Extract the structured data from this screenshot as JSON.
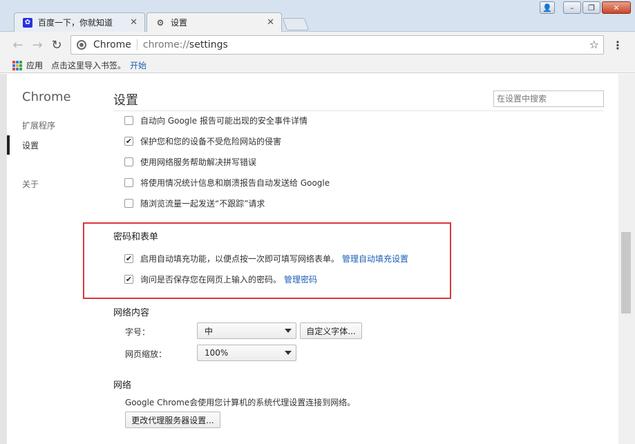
{
  "window": {
    "controls": {
      "user": "👤",
      "minimize": "–",
      "maximize": "❐",
      "close": "✕"
    }
  },
  "tabs": [
    {
      "title": "百度一下，你就知道",
      "icon": "baidu-paw-icon"
    },
    {
      "title": "设置",
      "icon": "gear-icon"
    }
  ],
  "toolbar": {
    "back": "←",
    "forward": "→",
    "reload": "↻",
    "chip": "Chrome",
    "url_scheme": "chrome://",
    "url_path": "settings",
    "star": "☆",
    "menu": "⋮"
  },
  "bookmarks": {
    "apps": "应用",
    "hint": "点击这里导入书签。",
    "start": "开始"
  },
  "sidebar": {
    "title": "Chrome",
    "items": [
      {
        "label": "扩展程序"
      },
      {
        "label": "设置"
      },
      {
        "label": "关于"
      }
    ]
  },
  "header": {
    "title": "设置",
    "search_placeholder": "在设置中搜索"
  },
  "privacy_options": [
    {
      "label": "自动向 Google 报告可能出现的安全事件详情",
      "checked": false,
      "mark": ""
    },
    {
      "label": "保护您和您的设备不受危险网站的侵害",
      "checked": true,
      "mark": "✔"
    },
    {
      "label": "使用网络服务帮助解决拼写错误",
      "checked": false,
      "mark": ""
    },
    {
      "label": "将使用情况统计信息和崩溃报告自动发送给 Google",
      "checked": false,
      "mark": ""
    },
    {
      "label": "随浏览流量一起发送“不跟踪”请求",
      "checked": false,
      "mark": ""
    }
  ],
  "passwords": {
    "heading": "密码和表单",
    "options": [
      {
        "label": "启用自动填充功能，以便点按一次即可填写网络表单。",
        "link": "管理自动填充设置",
        "checked": true,
        "mark": "✔"
      },
      {
        "label": "询问是否保存您在网页上输入的密码。",
        "link": "管理密码",
        "checked": true,
        "mark": "✔"
      }
    ]
  },
  "web_content": {
    "heading": "网络内容",
    "font_size_label": "字号：",
    "font_size_value": "中",
    "custom_fonts_button": "自定义字体...",
    "zoom_label": "网页缩放：",
    "zoom_value": "100%"
  },
  "network": {
    "heading": "网络",
    "description": "Google Chrome会使用您计算机的系统代理设置连接到网络。",
    "proxy_button": "更改代理服务器设置..."
  },
  "colors": {
    "link": "#1a5fb4",
    "highlight_border": "#d9363e"
  }
}
